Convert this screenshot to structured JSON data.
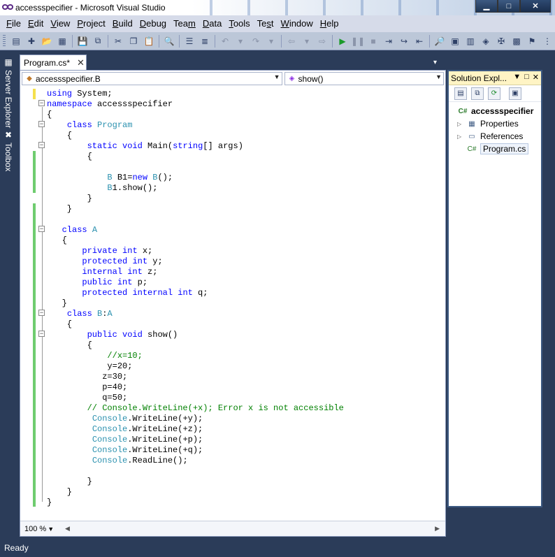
{
  "window": {
    "title": "accessspecifier - Microsoft Visual Studio",
    "minimize": "▁",
    "maximize": "□",
    "close": "✕"
  },
  "menu": [
    {
      "label": "File",
      "access": "F",
      "rest": "ile"
    },
    {
      "label": "Edit",
      "access": "E",
      "rest": "dit"
    },
    {
      "label": "View",
      "access": "V",
      "rest": "iew"
    },
    {
      "label": "Project",
      "access": "P",
      "rest": "roject"
    },
    {
      "label": "Build",
      "access": "B",
      "rest": "uild"
    },
    {
      "label": "Debug",
      "access": "D",
      "rest": "ebug"
    },
    {
      "label": "Team",
      "access": "",
      "pre": "Tea",
      "post": "m",
      "u": "m"
    },
    {
      "label": "Data",
      "access": "D",
      "rest": "ata"
    },
    {
      "label": "Tools",
      "access": "T",
      "rest": "ools"
    },
    {
      "label": "Test",
      "access": "s",
      "pre": "Te",
      "rest": "t"
    },
    {
      "label": "Window",
      "access": "W",
      "rest": "indow"
    },
    {
      "label": "Help",
      "access": "H",
      "rest": "elp"
    }
  ],
  "side_tabs": {
    "server_explorer": "Server Explorer",
    "toolbox": "Toolbox"
  },
  "document_tab": {
    "label": "Program.cs*",
    "close": "✕"
  },
  "navigation": {
    "class_combo": "accessspecifier.B",
    "member_combo": "show()"
  },
  "code_lines": [
    "using System;",
    "namespace accessspecifier",
    "{",
    "    class Program",
    "    {",
    "        static void Main(string[] args)",
    "        {",
    "",
    "            B B1=new B();",
    "            B1.show();",
    "        }",
    "    }",
    "",
    "   class A",
    "   {",
    "       private int x;",
    "       protected int y;",
    "       internal int z;",
    "       public int p;",
    "       protected internal int q;",
    "   }",
    "    class B:A",
    "    {",
    "        public void show()",
    "        {",
    "            //x=10;",
    "            y=20;",
    "           z=30;",
    "           p=40;",
    "           q=50;",
    "        // Console.WriteLine(+x); Error x is not accessible",
    "         Console.WriteLine(+y);",
    "         Console.WriteLine(+z);",
    "         Console.WriteLine(+p);",
    "         Console.WriteLine(+q);",
    "         Console.ReadLine();",
    "",
    "        }",
    "    }",
    "}"
  ],
  "zoom": "100 %",
  "solution_explorer": {
    "title": "Solution Expl...",
    "project": "accessspecifier",
    "items": [
      "Properties",
      "References",
      "Program.cs"
    ]
  },
  "status": "Ready",
  "colors": {
    "chrome": "#2b3c59",
    "keyword": "#0000ff",
    "type": "#2b91af",
    "comment": "#008000",
    "panel_header": "#fff4c4"
  }
}
